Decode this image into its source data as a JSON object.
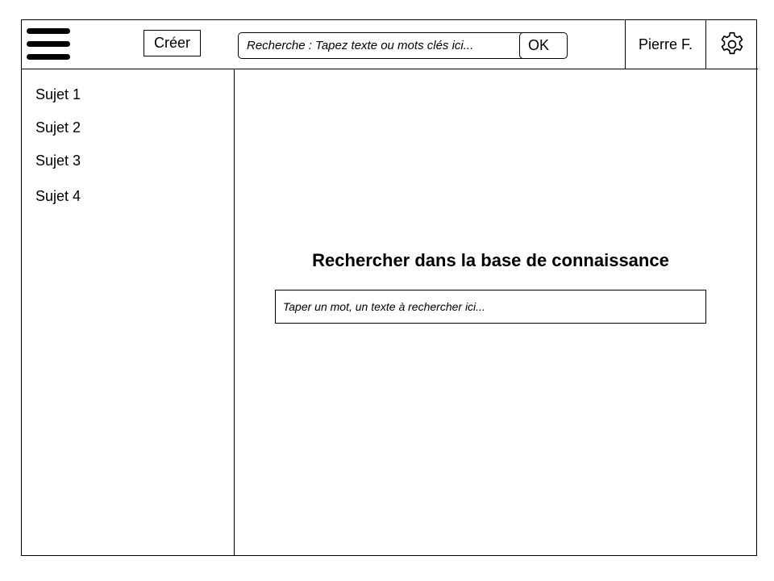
{
  "header": {
    "create_label": "Créer",
    "search_placeholder": "Recherche : Tapez texte ou mots clés ici...",
    "ok_label": "OK",
    "user_name": "Pierre F."
  },
  "icons": {
    "menu": "hamburger-menu-icon",
    "settings": "gear-icon"
  },
  "sidebar": {
    "items": [
      {
        "label": "Sujet 1"
      },
      {
        "label": "Sujet 2"
      },
      {
        "label": "Sujet 3"
      },
      {
        "label": "Sujet 4"
      }
    ]
  },
  "main": {
    "title": "Rechercher dans la base de connaissance",
    "search_placeholder": "Taper un mot, un texte à rechercher ici..."
  }
}
